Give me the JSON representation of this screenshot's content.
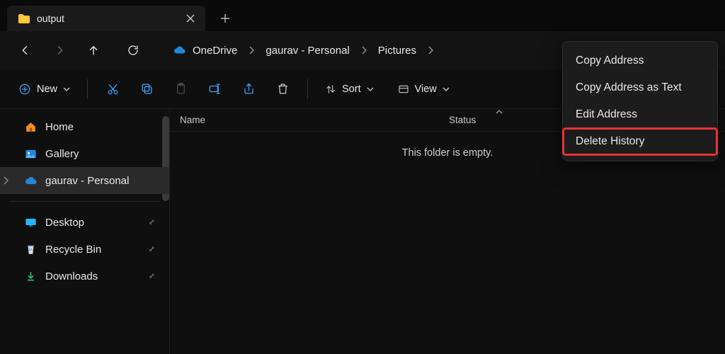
{
  "tab": {
    "title": "output"
  },
  "breadcrumbs": {
    "part0": "OneDrive",
    "part1": "gaurav - Personal",
    "part2": "Pictures"
  },
  "toolbar": {
    "new": "New",
    "sort": "Sort",
    "view": "View"
  },
  "columns": {
    "name": "Name",
    "status": "Status"
  },
  "sidebar": {
    "home": "Home",
    "gallery": "Gallery",
    "personal": "gaurav - Personal",
    "desktop": "Desktop",
    "recycle_bin": "Recycle Bin",
    "downloads": "Downloads"
  },
  "main": {
    "empty": "This folder is empty."
  },
  "context_menu": {
    "copy_address": "Copy Address",
    "copy_address_text": "Copy Address as Text",
    "edit_address": "Edit Address",
    "delete_history": "Delete History"
  },
  "colors": {
    "accent": "#3ea6ff",
    "highlight": "#e63434"
  }
}
